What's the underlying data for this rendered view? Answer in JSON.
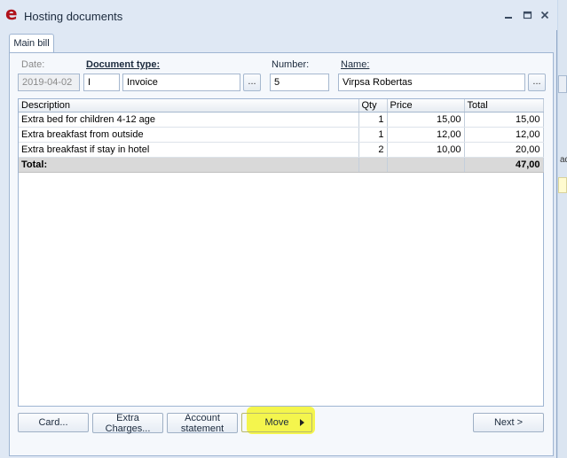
{
  "window": {
    "title": "Hosting documents",
    "accent_color": "#b0121b"
  },
  "tabs": [
    {
      "label": "Main bill",
      "active": true
    }
  ],
  "header": {
    "date_label": "Date:",
    "date_value": "2019-04-02",
    "doc_type_label": "Document type:",
    "doc_type_code": "I",
    "doc_type_name": "Invoice",
    "number_label": "Number:",
    "number_value": "5",
    "name_label": "Name:",
    "name_value": "Virpsa Robertas",
    "lookup_label": "..."
  },
  "grid": {
    "columns": [
      "Description",
      "Qty",
      "Price",
      "Total"
    ],
    "rows": [
      [
        "Extra bed for children 4-12 age",
        "1",
        "15,00",
        "15,00"
      ],
      [
        "Extra breakfast from outside",
        "1",
        "12,00",
        "12,00"
      ],
      [
        "Extra breakfast if stay in hotel",
        "2",
        "10,00",
        "20,00"
      ]
    ],
    "total_label": "Total:",
    "total_value": "47,00"
  },
  "buttons": {
    "card": "Card...",
    "extra_charges": "Extra Charges...",
    "account_statement": "Account statement",
    "move": "Move",
    "next": "Next >"
  },
  "background": {
    "text1": "ad"
  },
  "icons": {
    "app_logo": "app-logo-icon",
    "minimize": "minimize-icon",
    "restore": "restore-icon",
    "close": "close-icon",
    "submenu": "submenu-arrow-icon"
  }
}
